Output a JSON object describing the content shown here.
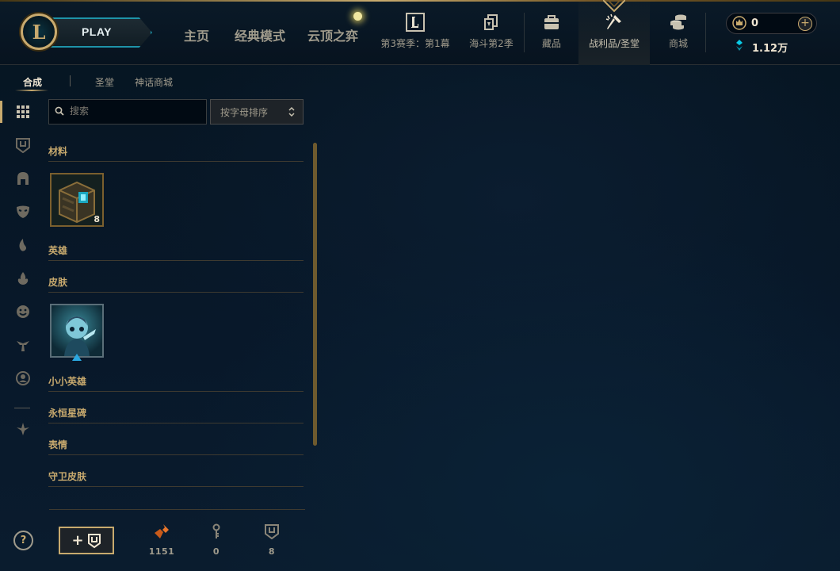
{
  "topbar": {
    "logo_letter": "L",
    "play_label": "PLAY",
    "nav_main": [
      "主页",
      "经典模式",
      "云顶之弈"
    ],
    "nav_items": [
      {
        "label": "第3赛季：第1幕",
        "icon": "ranked-l-icon"
      },
      {
        "label": "海斗第2季",
        "icon": "cards-icon"
      },
      {
        "label": "藏品",
        "icon": "collection-bag-icon"
      },
      {
        "label": "战利品/圣堂",
        "icon": "loot-hammer-icon"
      },
      {
        "label": "商城",
        "icon": "store-coins-icon"
      }
    ],
    "active_nav": "战利品/圣堂",
    "currency": {
      "rp_value": "0",
      "plus_symbol": "+",
      "be_value": "1.12万"
    }
  },
  "subtabs": [
    {
      "label": "合成",
      "active": true
    },
    {
      "label": "圣堂",
      "active": false
    },
    {
      "label": "神话商城",
      "active": false
    }
  ],
  "left_rail": [
    "grid-all-icon",
    "chest-icon",
    "champion-helmet-icon",
    "skin-mask-icon",
    "little-legend-icon",
    "ward-icon",
    "emote-icon",
    "eternals-icon",
    "icon-profile-icon",
    "warden-icon"
  ],
  "help_symbol": "?",
  "search": {
    "placeholder": "搜索"
  },
  "sort": {
    "label": "按字母排序"
  },
  "categories": {
    "materials": "材料",
    "champions": "英雄",
    "skins": "皮肤",
    "little_legends": "小小英雄",
    "eternals": "永恒星碑",
    "emotes": "表情",
    "ward_skins": "守卫皮肤"
  },
  "items": {
    "chest_count": "8"
  },
  "bottom_bar": {
    "add_chest_plus": "+",
    "orange_essence": "1151",
    "keys": "0",
    "chests": "8"
  },
  "colors": {
    "gold": "#c8aa6e",
    "teal": "#1e93a8",
    "orange_essence": "#e8762b",
    "blue_essence": "#0acbe6"
  }
}
